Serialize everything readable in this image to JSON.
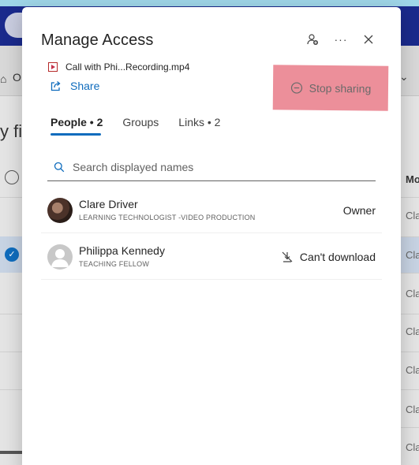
{
  "background": {
    "toolbar_letter": "O",
    "section_partial": "y fil",
    "column_header": "Mo",
    "column_cells": [
      "Cla",
      "Cla",
      "Cla",
      "Cla",
      "Cla",
      "Cla",
      "Cla"
    ]
  },
  "dialog": {
    "title": "Manage Access",
    "header_icons": [
      "add-person-icon",
      "more-options-icon",
      "close-icon"
    ],
    "more_label": "···",
    "file_name": "Call with Phi...Recording.mp4",
    "share_label": "Share",
    "stop_sharing_label": "Stop sharing",
    "tabs": [
      {
        "label": "People • 2",
        "active": true
      },
      {
        "label": "Groups",
        "active": false
      },
      {
        "label": "Links • 2",
        "active": false
      }
    ],
    "search_placeholder": "Search displayed names",
    "people": [
      {
        "name": "Clare Driver",
        "role": "LEARNING TECHNOLOGIST -VIDEO PRODUCTION",
        "permission": "Owner"
      },
      {
        "name": "Philippa Kennedy",
        "role": "TEACHING FELLOW",
        "permission": "Can't download"
      }
    ]
  },
  "colors": {
    "accent": "#0f6cbd",
    "highlight": "#ec8f9a",
    "header_bg": "#1a2a8c"
  }
}
